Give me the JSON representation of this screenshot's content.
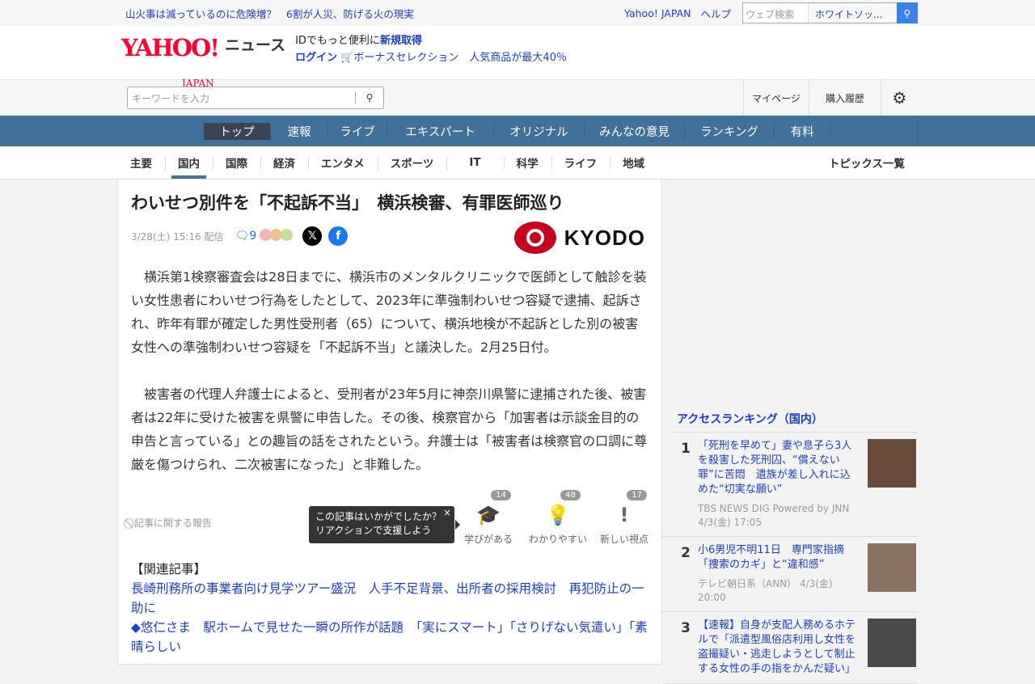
{
  "topbar": {
    "trend": [
      "山火事は減っているのに危険増？",
      "6割が人災、防げる火の現実"
    ],
    "yahoo_japan": "Yahoo! JAPAN",
    "help": "ヘルプ",
    "search_placeholder": "ウェブ検索",
    "suggest": "ホワイトソッ..."
  },
  "header": {
    "logo": "YAHOO! JAPAN",
    "logo_yahoo": "YAHOO!",
    "logo_japan": "JAPAN",
    "news": "ニュース",
    "id_text": "IDでもっと便利に",
    "signup": "新規取得",
    "login": "ログイン",
    "promo": "ボーナスセレクション　人気商品が最大40％"
  },
  "search": {
    "placeholder": "キーワードを入力",
    "mypage": "マイページ",
    "history": "購入履歴"
  },
  "nav": [
    "トップ",
    "速報",
    "ライブ",
    "エキスパート",
    "オリジナル",
    "みんなの意見",
    "ランキング",
    "有料"
  ],
  "subnav": [
    "主要",
    "国内",
    "国際",
    "経済",
    "エンタメ",
    "スポーツ",
    "IT",
    "科学",
    "ライフ",
    "地域"
  ],
  "topics_all": "トピックス一覧",
  "article": {
    "title": "わいせつ別件を「不起訴不当」　横浜検審、有罪医師巡り",
    "date": "3/28(土) 15:16 配信",
    "comments": "9",
    "source": "KYODO",
    "paragraphs": [
      "横浜第1検察審査会は28日までに、横浜市のメンタルクリニックで医師として触診を装い女性患者にわいせつ行為をしたとして、2023年に準強制わいせつ容疑で逮捕、起訴され、昨年有罪が確定した男性受刑者（65）について、横浜地検が不起訴とした別の被害女性への準強制わいせつ容疑を「不起訴不当」と議決した。2月25日付。",
      "被害者の代理人弁護士によると、受刑者が23年5月に神奈川県警に逮捕された後、被害者は22年に受けた被害を県警に申告した。その後、検察官から「加害者は示談金目的の申告と言っている」との趣旨の話をされたという。弁護士は「被害者は検察官の口調に尊厳を傷つけられ、二次被害になった」と非難した。"
    ],
    "report": "記事に関する報告",
    "tip_line1": "この記事はいかがでしたか？",
    "tip_line2": "リアクションで支援しよう",
    "reactions": [
      {
        "label": "学びがある",
        "count": "14"
      },
      {
        "label": "わかりやすい",
        "count": "48"
      },
      {
        "label": "新しい視点",
        "count": "17"
      }
    ],
    "related_heading": "【関連記事】",
    "related": [
      "長崎刑務所の事業者向け見学ツアー盛況　人手不足背景、出所者の採用検討　再犯防止の一助に",
      "◆悠仁さま　駅ホームで見せた一瞬の所作が話題　「実にスマート」「さりげない気遣い」「素晴らしい"
    ]
  },
  "ranking": {
    "heading": "アクセスランキング（国内）",
    "items": [
      {
        "no": "1",
        "title": "「死刑を早めて」妻や息子ら3人を殺害した死刑囚、“償えない罪”に苦悶　遺族が差し入れに込めた“切実な願い”",
        "source": "TBS NEWS DIG Powered by JNN",
        "date": "4/3(金) 17:05"
      },
      {
        "no": "2",
        "title": "小6男児不明11日　専門家指摘「捜索のカギ」と“違和感”",
        "source": "テレビ朝日系（ANN）",
        "date": "4/3(金) 20:00"
      },
      {
        "no": "3",
        "title": "【速報】自身が支配人務めるホテルで「派遣型風俗店利用し女性を盗撮疑い・逃走しようとして制止する女性の手の指をかんだ疑い」",
        "source": "",
        "date": ""
      }
    ]
  }
}
